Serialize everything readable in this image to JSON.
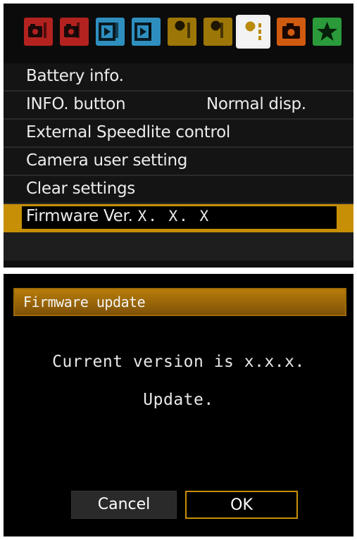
{
  "top_screen": {
    "tabs": [
      {
        "name": "shooting-1",
        "color": "#b3221f",
        "active": false
      },
      {
        "name": "shooting-2",
        "color": "#b3221f",
        "active": false
      },
      {
        "name": "playback-1",
        "color": "#2e8fbf",
        "active": false
      },
      {
        "name": "playback-2",
        "color": "#2e8fbf",
        "active": false
      },
      {
        "name": "setup-1",
        "color": "#b98b07",
        "active": false
      },
      {
        "name": "setup-2",
        "color": "#b98b07",
        "active": false
      },
      {
        "name": "setup-3",
        "color": "#b98b07",
        "active": true
      },
      {
        "name": "custom-functions",
        "color": "#d05a10",
        "active": false
      },
      {
        "name": "my-menu",
        "color": "#2a9a3a",
        "active": false
      }
    ],
    "menu": {
      "items": [
        {
          "label": "Battery info.",
          "value": ""
        },
        {
          "label": "INFO. button",
          "value": "Normal disp."
        },
        {
          "label": "External Speedlite control",
          "value": ""
        },
        {
          "label": "Camera user setting",
          "value": ""
        },
        {
          "label": "Clear settings",
          "value": ""
        }
      ],
      "selected": {
        "label": "Firmware Ver.",
        "version": "X. X. X"
      }
    },
    "colors": {
      "highlight": "#c78f05"
    }
  },
  "bottom_screen": {
    "title": "Firmware update",
    "message_line1": "Current version is x.x.x.",
    "message_line2": "Update.",
    "buttons": {
      "cancel": "Cancel",
      "ok": "OK"
    }
  }
}
